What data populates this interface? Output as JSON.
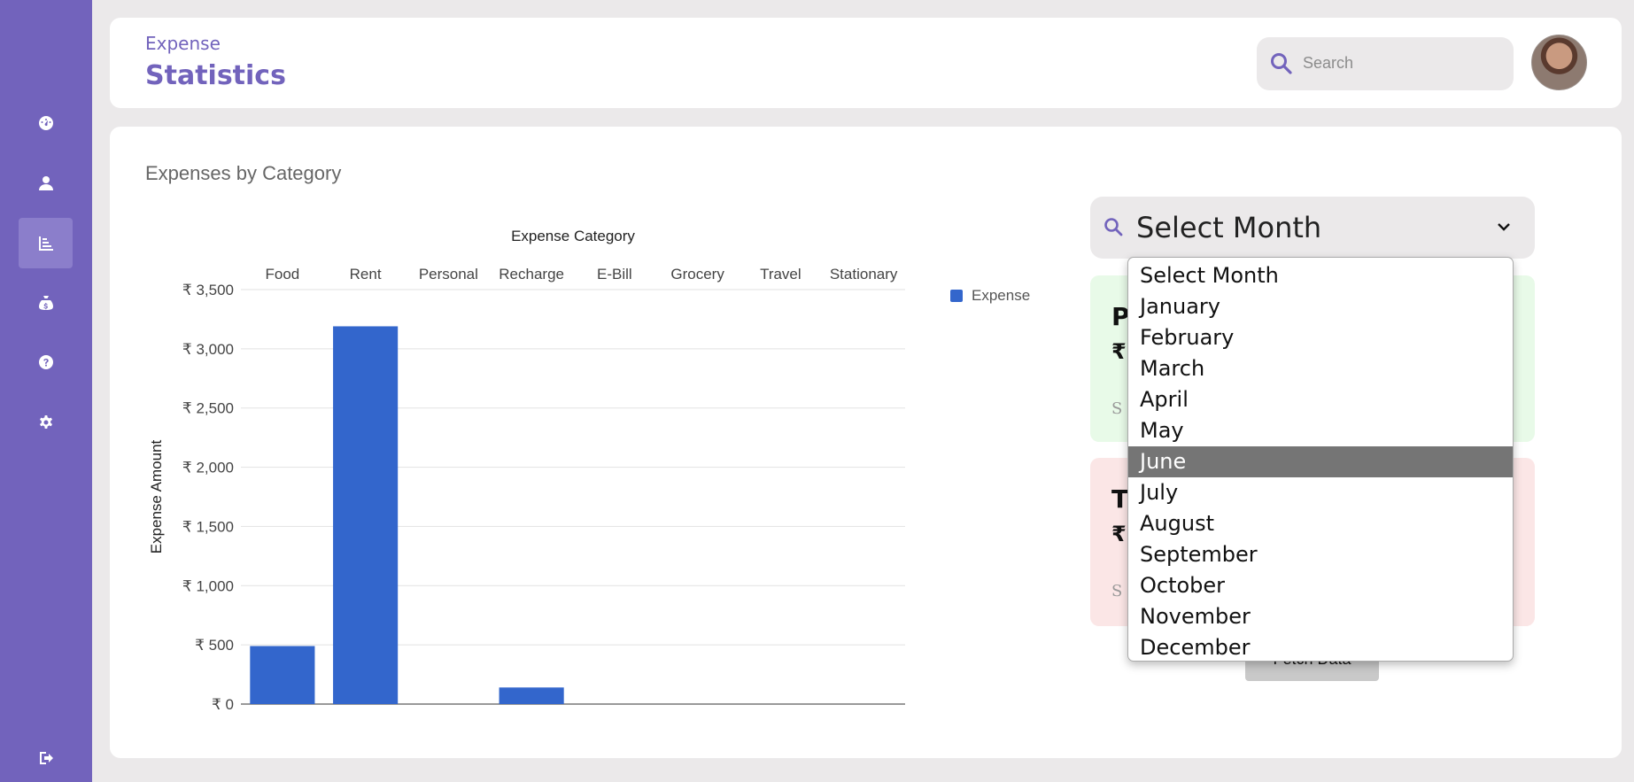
{
  "header": {
    "subtitle": "Expense",
    "title": "Statistics",
    "search_placeholder": "Search"
  },
  "sidebar": {
    "items": [
      {
        "icon": "dashboard-icon",
        "active": false
      },
      {
        "icon": "user-icon",
        "active": false
      },
      {
        "icon": "chart-icon",
        "active": true
      },
      {
        "icon": "money-bag-icon",
        "active": false
      },
      {
        "icon": "help-icon",
        "active": false
      },
      {
        "icon": "settings-icon",
        "active": false
      },
      {
        "icon": "logout-icon",
        "active": false
      }
    ]
  },
  "main": {
    "card_title": "Expenses by Category",
    "month_select": {
      "value": "Select Month",
      "options": [
        "Select Month",
        "January",
        "February",
        "March",
        "April",
        "May",
        "June",
        "July",
        "August",
        "September",
        "October",
        "November",
        "December"
      ],
      "highlighted": "June"
    },
    "green_card": {
      "letter": "P",
      "rupee": "₹",
      "small": "S"
    },
    "red_card": {
      "letter": "T",
      "rupee": "₹",
      "small": "S"
    },
    "fetch_button": "Fetch Data"
  },
  "colors": {
    "sidebar": "#7263bc",
    "accent": "#7263bc",
    "bar": "#3366cc",
    "background": "#ebe9ea"
  },
  "chart_data": {
    "type": "bar",
    "title": "Expense Category",
    "xlabel": "Expense Category",
    "ylabel": "Expense Amount",
    "categories": [
      "Food",
      "Rent",
      "Personal",
      "Recharge",
      "E-Bill",
      "Grocery",
      "Travel",
      "Stationary"
    ],
    "series": [
      {
        "name": "Expense",
        "values": [
          490,
          3190,
          0,
          140,
          0,
          0,
          0,
          0
        ]
      }
    ],
    "ylim": [
      0,
      3500
    ],
    "yticks": [
      0,
      500,
      1000,
      1500,
      2000,
      2500,
      3000,
      3500
    ],
    "ytick_labels": [
      "₹ 0",
      "₹ 500",
      "₹ 1,000",
      "₹ 1,500",
      "₹ 2,000",
      "₹ 2,500",
      "₹ 3,000",
      "₹ 3,500"
    ],
    "legend": "right",
    "grid": true
  }
}
